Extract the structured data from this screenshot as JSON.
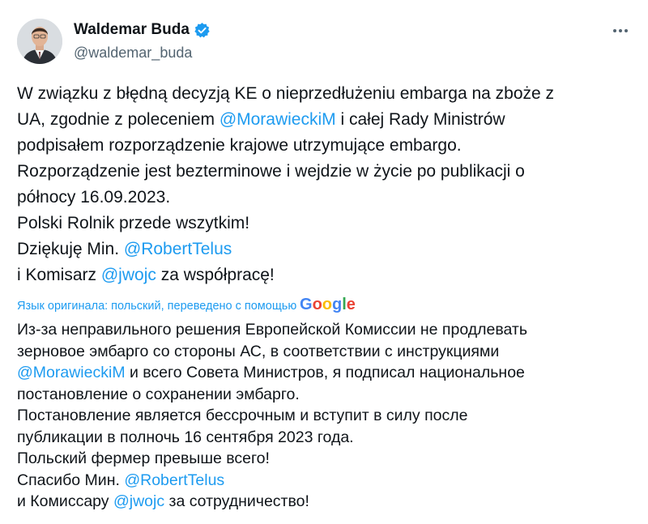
{
  "author": {
    "display_name": "Waldemar Buda",
    "handle": "@waldemar_buda",
    "verified_color": "#1d9bf0",
    "avatar_icon": "person-photo"
  },
  "original_text": {
    "lines": [
      [
        {
          "t": "W związku z błędną decyzją KE o nieprzedłużeniu embarga na zboże z"
        }
      ],
      [
        {
          "t": "UA, zgodnie z poleceniem "
        },
        {
          "t": "@MorawieckiM",
          "link": true
        },
        {
          "t": " i całej Rady Ministrów"
        }
      ],
      [
        {
          "t": "podpisałem rozporządzenie krajowe utrzymujące embargo."
        }
      ],
      [
        {
          "t": "Rozporządzenie jest bezterminowe i wejdzie w życie po publikacji o"
        }
      ],
      [
        {
          "t": "północy 16.09.2023."
        }
      ],
      [
        {
          "t": "Polski Rolnik przede wszytkim!"
        }
      ],
      [
        {
          "t": "Dziękuję Min. "
        },
        {
          "t": "@RobertTelus",
          "link": true
        }
      ],
      [
        {
          "t": "i Komisarz "
        },
        {
          "t": "@jwojc",
          "link": true
        },
        {
          "t": " za współpracę!"
        }
      ]
    ]
  },
  "translation_note": {
    "text": "Язык оригинала: польский, переведено с помощью",
    "provider": "Google"
  },
  "translated_text": {
    "lines": [
      [
        {
          "t": "Из-за неправильного решения Европейской Комиссии не продлевать"
        }
      ],
      [
        {
          "t": "зерновое эмбарго со стороны АС, в соответствии с инструкциями"
        }
      ],
      [
        {
          "t": "@MorawieckiM",
          "link": true
        },
        {
          "t": " и всего Совета Министров, я подписал национальное"
        }
      ],
      [
        {
          "t": "постановление о сохранении эмбарго."
        }
      ],
      [
        {
          "t": "Постановление является бессрочным и вступит в силу после"
        }
      ],
      [
        {
          "t": "публикации в полночь 16 сентября 2023 года."
        }
      ],
      [
        {
          "t": "Польский фермер превыше всего!"
        }
      ],
      [
        {
          "t": "Спасибо Мин. "
        },
        {
          "t": "@RobertTelus",
          "link": true
        }
      ],
      [
        {
          "t": "и Комиссару "
        },
        {
          "t": "@jwojc",
          "link": true
        },
        {
          "t": " за сотрудничество!"
        }
      ]
    ]
  },
  "colors": {
    "text": "#0f1419",
    "secondary": "#536471",
    "link": "#1d9bf0"
  }
}
